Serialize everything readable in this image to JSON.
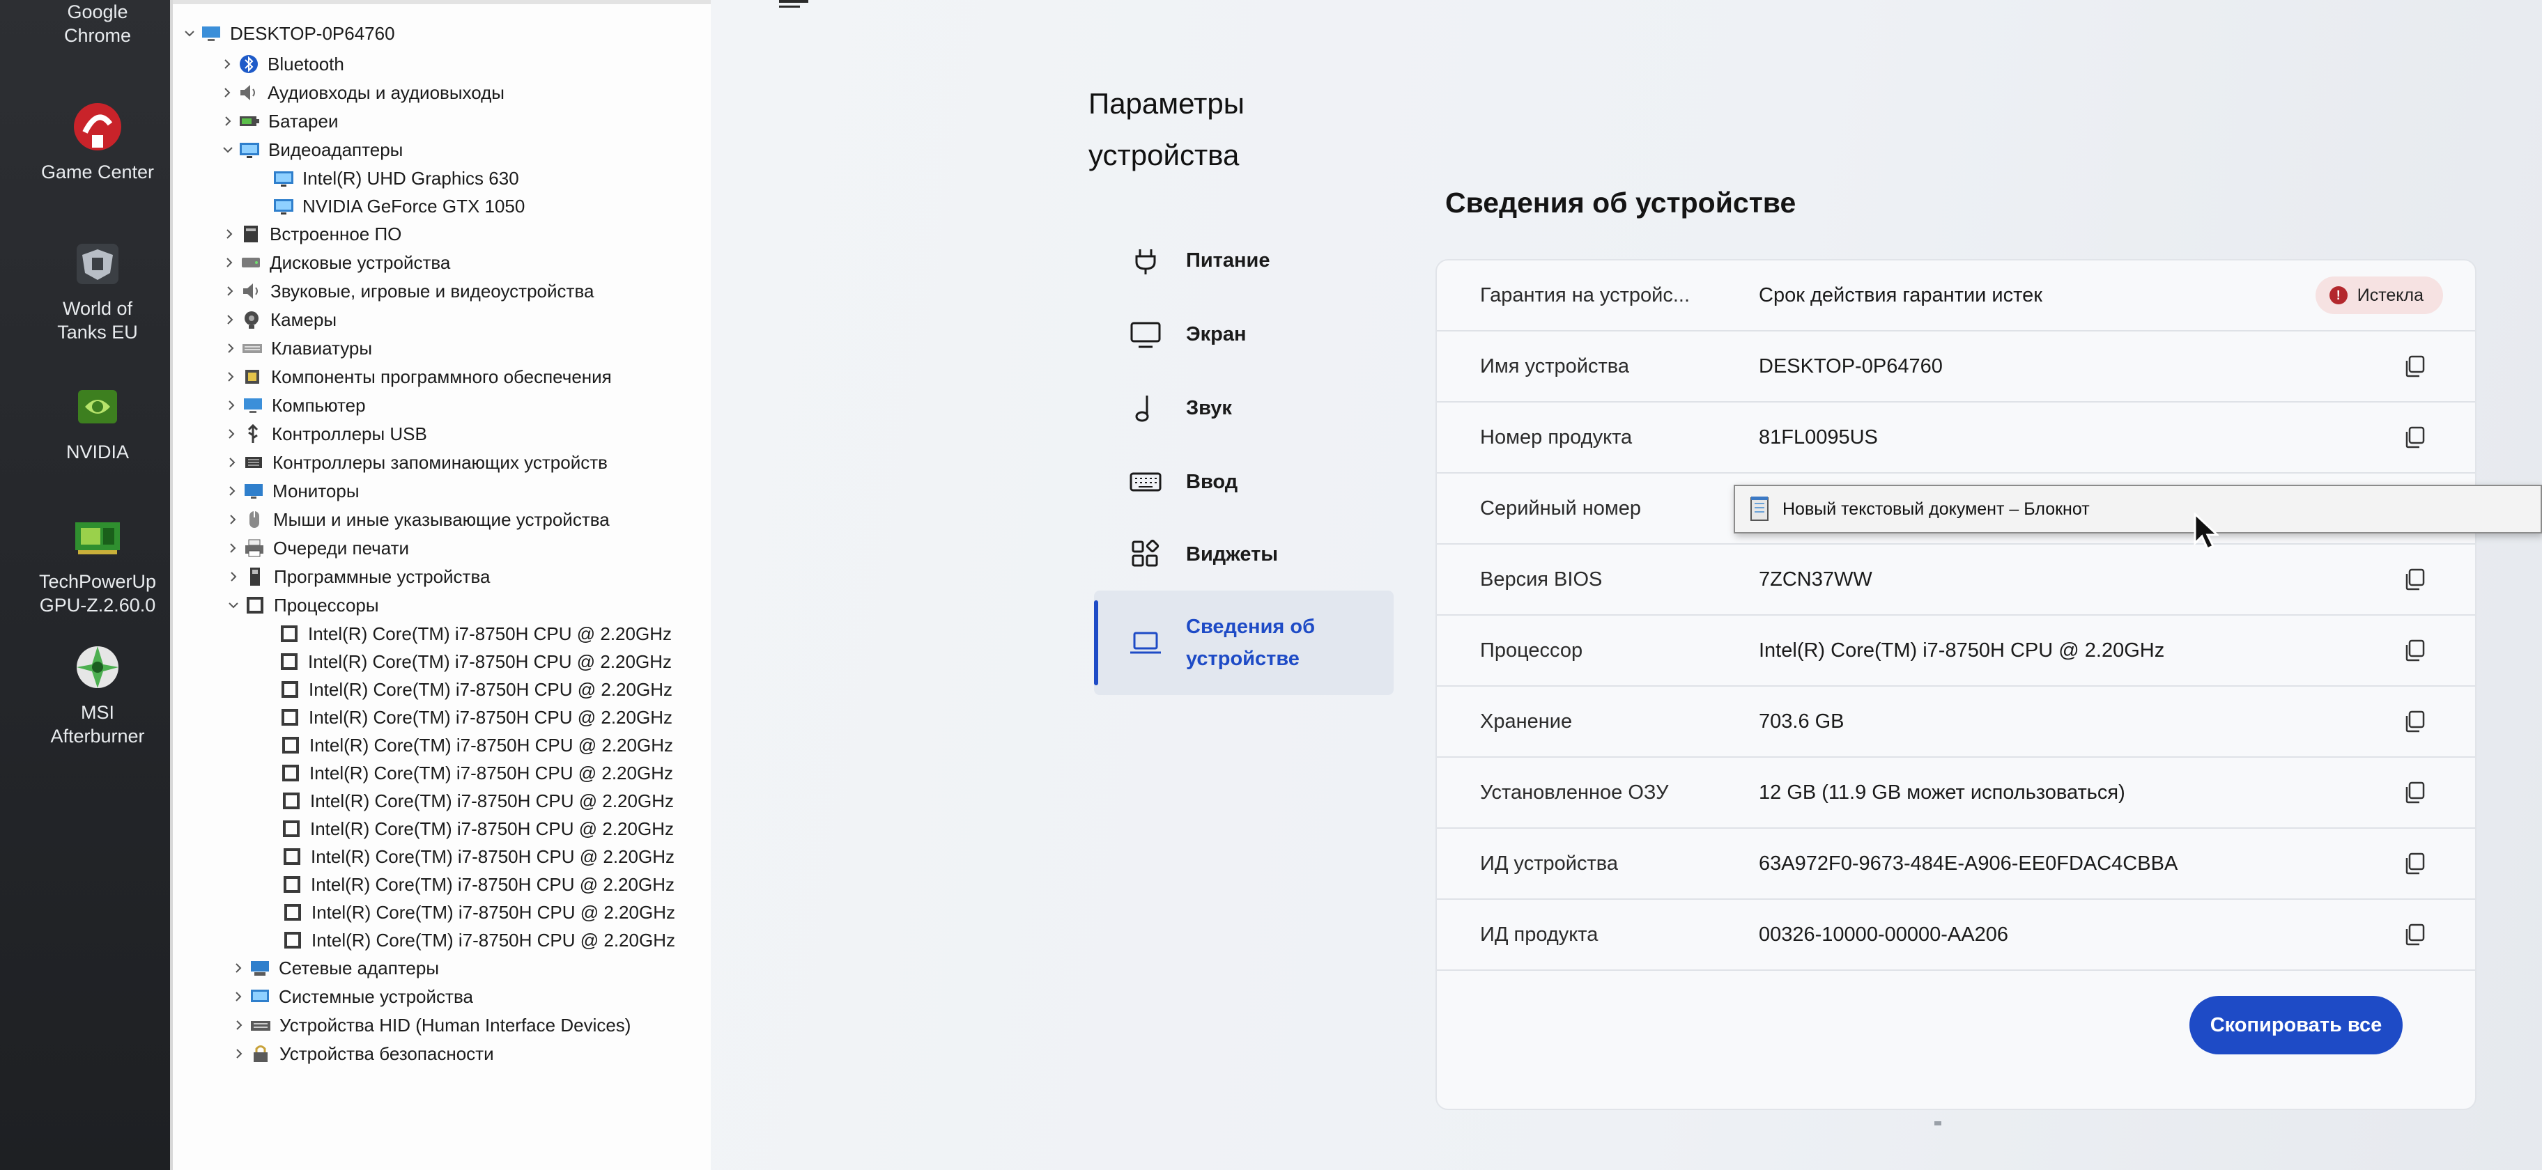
{
  "desktop": {
    "icons": [
      {
        "label1": "Google",
        "label2": "Chrome",
        "icon": "chrome-icon"
      },
      {
        "label1": "Game Center",
        "label2": "",
        "icon": "game-center-icon"
      },
      {
        "label1": "World of",
        "label2": "Tanks EU",
        "icon": "world-of-tanks-icon"
      },
      {
        "label1": "NVIDIA",
        "label2": "",
        "icon": "nvidia-icon"
      },
      {
        "label1": "TechPowerUp",
        "label2": "GPU-Z.2.60.0",
        "icon": "gpu-z-icon"
      },
      {
        "label1": "MSI",
        "label2": "Afterburner",
        "icon": "msi-afterburner-icon"
      }
    ]
  },
  "device_manager": {
    "root": "DESKTOP-0P64760",
    "items": [
      {
        "label": "Bluetooth",
        "icon": "bluetooth-icon"
      },
      {
        "label": "Аудиовходы и аудиовыходы",
        "icon": "speaker-icon"
      },
      {
        "label": "Батареи",
        "icon": "battery-icon"
      },
      {
        "label": "Видеоадаптеры",
        "icon": "display-adapter-icon",
        "expanded": true
      },
      {
        "label": "Intel(R) UHD Graphics 630",
        "icon": "display-adapter-icon"
      },
      {
        "label": "NVIDIA GeForce GTX 1050",
        "icon": "display-adapter-icon"
      },
      {
        "label": "Встроенное ПО",
        "icon": "firmware-icon"
      },
      {
        "label": "Дисковые устройства",
        "icon": "disk-icon"
      },
      {
        "label": "Звуковые, игровые и видеоустройства",
        "icon": "speaker-icon"
      },
      {
        "label": "Камеры",
        "icon": "camera-icon"
      },
      {
        "label": "Клавиатуры",
        "icon": "keyboard-icon"
      },
      {
        "label": "Компоненты программного обеспечения",
        "icon": "software-component-icon"
      },
      {
        "label": "Компьютер",
        "icon": "computer-icon"
      },
      {
        "label": "Контроллеры USB",
        "icon": "usb-icon"
      },
      {
        "label": "Контроллеры запоминающих устройств",
        "icon": "storage-controller-icon"
      },
      {
        "label": "Мониторы",
        "icon": "monitor-icon"
      },
      {
        "label": "Мыши и иные указывающие устройства",
        "icon": "mouse-icon"
      },
      {
        "label": "Очереди печати",
        "icon": "printer-icon"
      },
      {
        "label": "Программные устройства",
        "icon": "software-device-icon"
      },
      {
        "label": "Процессоры",
        "icon": "processor-icon",
        "expanded": true
      },
      {
        "label": "Intel(R) Core(TM) i7-8750H CPU @ 2.20GHz",
        "icon": "processor-icon"
      },
      {
        "label": "Intel(R) Core(TM) i7-8750H CPU @ 2.20GHz",
        "icon": "processor-icon"
      },
      {
        "label": "Intel(R) Core(TM) i7-8750H CPU @ 2.20GHz",
        "icon": "processor-icon"
      },
      {
        "label": "Intel(R) Core(TM) i7-8750H CPU @ 2.20GHz",
        "icon": "processor-icon"
      },
      {
        "label": "Intel(R) Core(TM) i7-8750H CPU @ 2.20GHz",
        "icon": "processor-icon"
      },
      {
        "label": "Intel(R) Core(TM) i7-8750H CPU @ 2.20GHz",
        "icon": "processor-icon"
      },
      {
        "label": "Intel(R) Core(TM) i7-8750H CPU @ 2.20GHz",
        "icon": "processor-icon"
      },
      {
        "label": "Intel(R) Core(TM) i7-8750H CPU @ 2.20GHz",
        "icon": "processor-icon"
      },
      {
        "label": "Intel(R) Core(TM) i7-8750H CPU @ 2.20GHz",
        "icon": "processor-icon"
      },
      {
        "label": "Intel(R) Core(TM) i7-8750H CPU @ 2.20GHz",
        "icon": "processor-icon"
      },
      {
        "label": "Intel(R) Core(TM) i7-8750H CPU @ 2.20GHz",
        "icon": "processor-icon"
      },
      {
        "label": "Intel(R) Core(TM) i7-8750H CPU @ 2.20GHz",
        "icon": "processor-icon"
      },
      {
        "label": "Сетевые адаптеры",
        "icon": "network-adapter-icon"
      },
      {
        "label": "Системные устройства",
        "icon": "system-device-icon"
      },
      {
        "label": "Устройства HID (Human Interface Devices)",
        "icon": "hid-icon"
      },
      {
        "label": "Устройства безопасности",
        "icon": "security-device-icon"
      }
    ]
  },
  "settings": {
    "page_title": "Параметры устройства",
    "nav": [
      {
        "label": "Питание",
        "icon": "power-plug-icon"
      },
      {
        "label": "Экран",
        "icon": "monitor-icon"
      },
      {
        "label": "Звук",
        "icon": "music-note-icon"
      },
      {
        "label": "Ввод",
        "icon": "keyboard-icon"
      },
      {
        "label": "Виджеты",
        "icon": "widgets-icon"
      },
      {
        "label": "Сведения об устройстве",
        "icon": "laptop-icon",
        "active": true
      }
    ],
    "section_title": "Сведения об устройстве",
    "rows": [
      {
        "label": "Гарантия на устройс...",
        "value": "Срок действия гарантии истек",
        "badge": "Истекла"
      },
      {
        "label": "Имя устройства",
        "value": "DESKTOP-0P64760"
      },
      {
        "label": "Номер продукта",
        "value": "81FL0095US"
      },
      {
        "label": "Серийный номер",
        "value": ""
      },
      {
        "label": "Версия BIOS",
        "value": "7ZCN37WW"
      },
      {
        "label": "Процессор",
        "value": "Intel(R) Core(TM) i7-8750H CPU @ 2.20GHz"
      },
      {
        "label": "Хранение",
        "value": "703.6 GB"
      },
      {
        "label": "Установленное ОЗУ",
        "value": "12 GB (11.9 GB может использоваться)"
      },
      {
        "label": "ИД устройства",
        "value": "63A972F0-9673-484E-A906-EE0FDAC4CBBA"
      },
      {
        "label": "ИД продукта",
        "value": "00326-10000-00000-AA206"
      }
    ],
    "copy_all_label": "Скопировать все",
    "accent_color": "#1e4bc6",
    "expired_color": "#b3282d"
  },
  "tooltip": {
    "text": "Новый текстовый документ – Блокнот",
    "icon": "notepad-icon"
  }
}
